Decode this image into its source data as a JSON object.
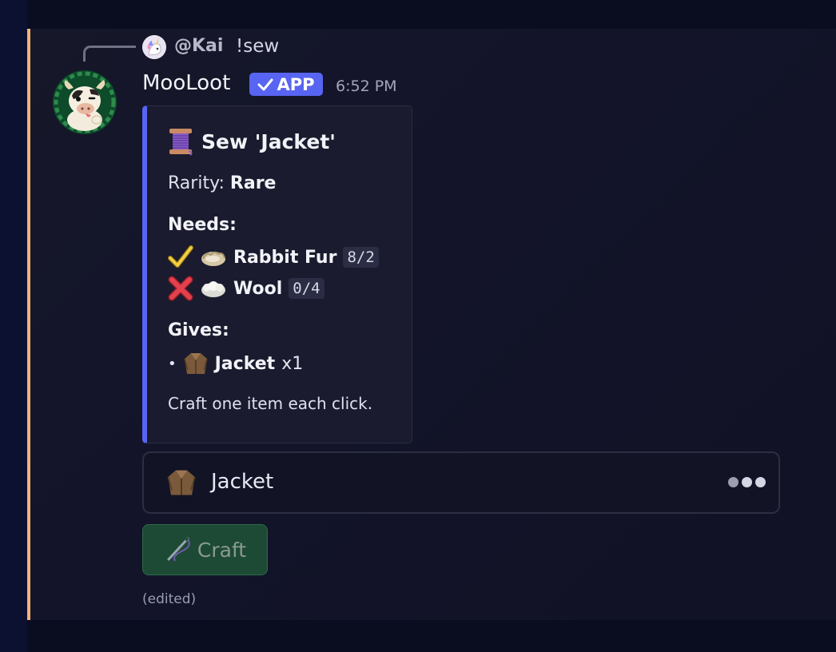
{
  "reply": {
    "author": "@Kai",
    "content": "!sew"
  },
  "message": {
    "author": "MooLoot",
    "badge": "APP",
    "timestamp": "6:52 PM",
    "edited": "(edited)"
  },
  "embed": {
    "title": "Sew 'Jacket'",
    "rarity_label": "Rarity:",
    "rarity_value": "Rare",
    "needs_heading": "Needs:",
    "needs": [
      {
        "status": "check-icon",
        "item_icon": "fur-icon",
        "name": "Rabbit Fur",
        "count": "8/2"
      },
      {
        "status": "cross-icon",
        "item_icon": "wool-icon",
        "name": "Wool",
        "count": "0/4"
      }
    ],
    "gives_heading": "Gives:",
    "gives": {
      "bullet": "•",
      "item_icon": "jacket-icon",
      "name": "Jacket",
      "qty": "x1"
    },
    "footer": "Craft one item each click."
  },
  "select_menu": {
    "selected": "Jacket",
    "icon": "jacket-icon"
  },
  "button": {
    "label": "Craft",
    "icon": "needle-icon"
  },
  "colors": {
    "mention_bar": "#f0b27a",
    "accent": "#5865f2",
    "button_bg": "#1d4a34"
  }
}
